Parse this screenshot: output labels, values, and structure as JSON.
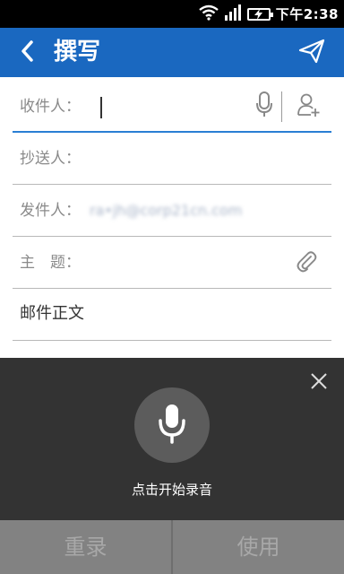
{
  "status_bar": {
    "time": "下午2:38",
    "icons": [
      "wifi-icon",
      "signal-icon",
      "battery-charging-icon"
    ]
  },
  "app_bar": {
    "title": "撰写",
    "back_icon": "chevron-left-icon",
    "send_icon": "send-icon"
  },
  "form": {
    "to_label": "收件人：",
    "cc_label": "抄送人：",
    "from_label": "发件人：",
    "from_value": "ra•jh@corp21cn.com",
    "subject_label": "主　题：",
    "body_placeholder": "邮件正文"
  },
  "voice_panel": {
    "hint": "点击开始录音"
  },
  "buttons": {
    "rerecord": "重录",
    "use": "使用"
  },
  "colors": {
    "accent": "#1a68c0",
    "active_underline": "#2a7fd4",
    "panel_bg": "#333333",
    "bottom_bar_bg": "#828282"
  }
}
